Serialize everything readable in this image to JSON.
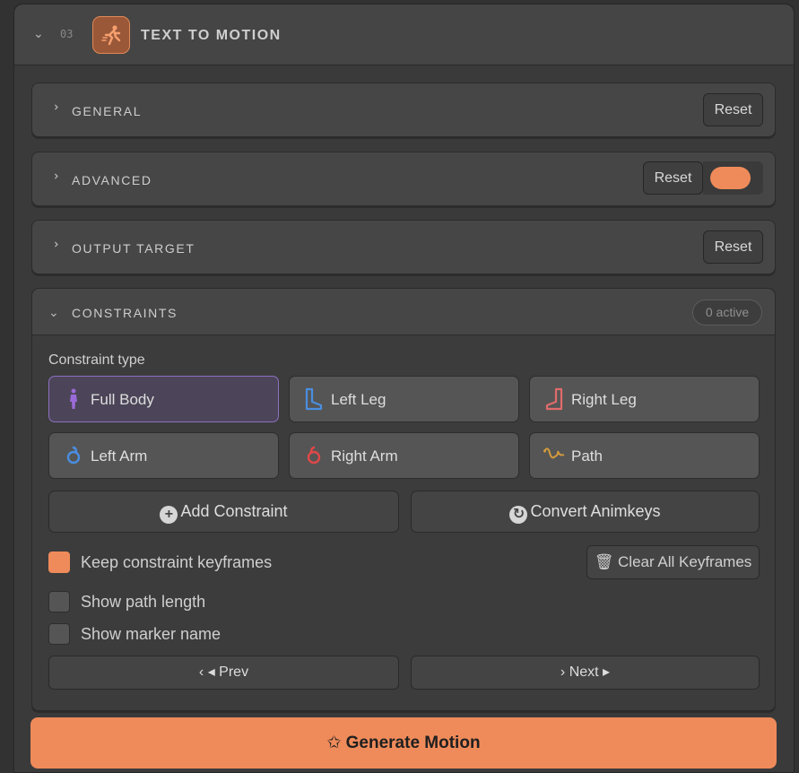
{
  "panel": {
    "number": "03",
    "title": "TEXT TO MOTION"
  },
  "sections": {
    "general": {
      "title": "GENERAL",
      "reset": "Reset"
    },
    "advanced": {
      "title": "ADVANCED",
      "reset": "Reset",
      "toggle_on": true
    },
    "output_target": {
      "title": "OUTPUT TARGET",
      "reset": "Reset"
    }
  },
  "constraints": {
    "title": "CONSTRAINTS",
    "badge": "0 active",
    "type_label": "Constraint type",
    "types": [
      {
        "label": "Full Body",
        "icon": "full-body-icon",
        "selected": true
      },
      {
        "label": "Left Leg",
        "icon": "left-leg-icon",
        "selected": false
      },
      {
        "label": "Right Leg",
        "icon": "right-leg-icon",
        "selected": false
      },
      {
        "label": "Left Arm",
        "icon": "left-arm-icon",
        "selected": false
      },
      {
        "label": "Right Arm",
        "icon": "right-arm-icon",
        "selected": false
      },
      {
        "label": "Path",
        "icon": "path-icon",
        "selected": false
      }
    ],
    "add_button": "Add Constraint",
    "convert_button": "Convert Animkeys",
    "keep_keyframes": {
      "label": "Keep constraint keyframes",
      "checked": true
    },
    "clear_button": "Clear All Keyframes",
    "show_path_length": {
      "label": "Show path length",
      "checked": false
    },
    "show_marker_name": {
      "label": "Show marker name",
      "checked": false
    },
    "prev_button": "◂ Prev",
    "next_button": "Next ▸"
  },
  "generate_button": "Generate Motion",
  "colors": {
    "accent": "#ef8b5a",
    "selected_border": "#8c70c0",
    "background": "#3a3a3a"
  }
}
